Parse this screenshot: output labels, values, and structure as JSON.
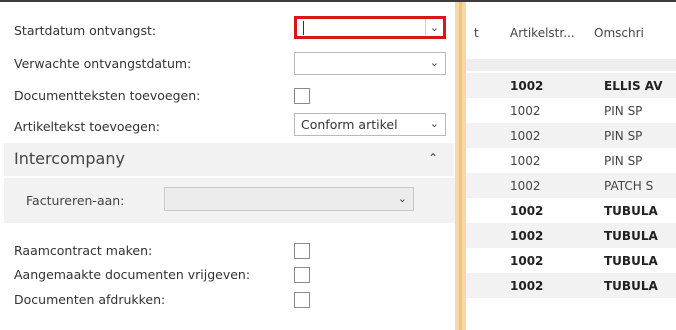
{
  "form": {
    "start_date_label": "Startdatum ontvangst:",
    "start_date_value": "",
    "expected_date_label": "Verwachte ontvangstdatum:",
    "expected_date_value": "",
    "doc_texts_label": "Documentteksten toevoegen:",
    "item_text_label": "Artikeltekst toevoegen:",
    "item_text_value": "Conform artikel",
    "section_title": "Intercompany",
    "invoice_to_label": "Factureren-aan:",
    "invoice_to_value": "",
    "frame_contract_label": "Raamcontract maken:",
    "release_docs_label": "Aangemaakte documenten vrijgeven:",
    "print_docs_label": "Documenten afdrukken:"
  },
  "grid": {
    "col_t": "t",
    "col_item": "Artikelstr...",
    "col_desc": "Omschri",
    "rows": [
      {
        "num": "1002",
        "desc": "ELLIS AV",
        "bold": true
      },
      {
        "num": "1002",
        "desc": "PIN SP",
        "bold": false
      },
      {
        "num": "1002",
        "desc": "PIN SP",
        "bold": false
      },
      {
        "num": "1002",
        "desc": "PIN SP",
        "bold": false
      },
      {
        "num": "1002",
        "desc": "PATCH S",
        "bold": false
      },
      {
        "num": "1002",
        "desc": "TUBULA",
        "bold": true
      },
      {
        "num": "1002",
        "desc": "TUBULA",
        "bold": true
      },
      {
        "num": "1002",
        "desc": "TUBULA",
        "bold": true
      },
      {
        "num": "1002",
        "desc": "TUBULA",
        "bold": true
      }
    ]
  },
  "colors": {
    "highlight_border": "#d9161b",
    "splitter": "#f6d9a2",
    "section_bg": "#f2f2f2"
  },
  "icons": {
    "dropdown": "chevron-down-icon",
    "collapse": "chevron-up-icon"
  }
}
